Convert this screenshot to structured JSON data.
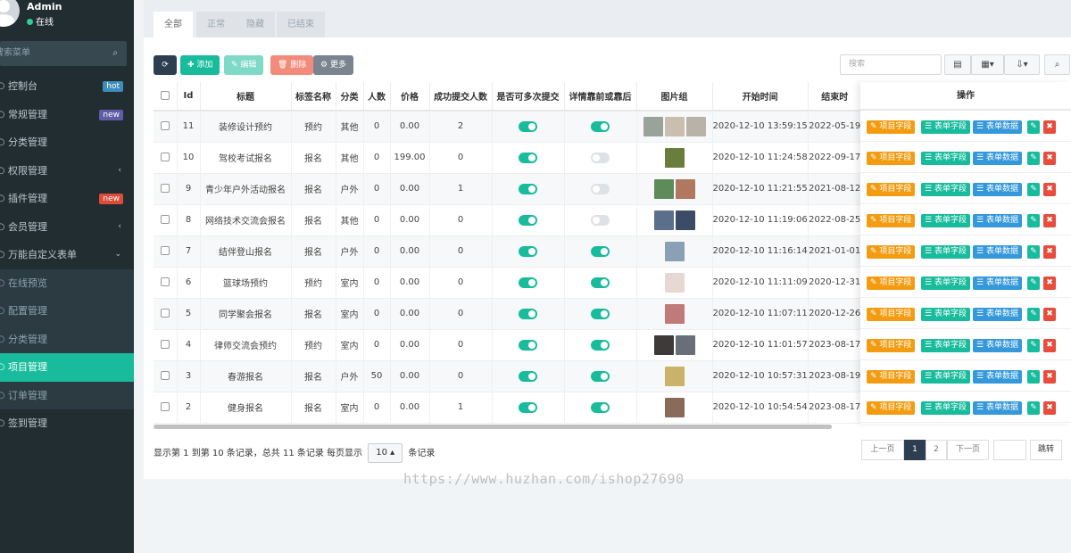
{
  "user": {
    "name": "Admin",
    "status": "在线"
  },
  "sidebar": {
    "search_placeholder": "搜索菜单",
    "items": [
      {
        "label": "控制台",
        "badge": "hot",
        "badge_color": "#3c8dbc"
      },
      {
        "label": "常规管理",
        "badge": "new",
        "badge_color": "#605ca8"
      },
      {
        "label": "分类管理"
      },
      {
        "label": "权限管理",
        "arrow": "‹"
      },
      {
        "label": "插件管理",
        "badge": "new",
        "badge_color": "#dd4b39"
      },
      {
        "label": "会员管理",
        "arrow": "‹"
      },
      {
        "label": "万能自定义表单",
        "arrow": "⌄"
      },
      {
        "label": "在线预览",
        "sub": true
      },
      {
        "label": "配置管理",
        "sub": true
      },
      {
        "label": "分类管理",
        "sub": true
      },
      {
        "label": "项目管理",
        "active": true
      },
      {
        "label": "订单管理",
        "sub": true
      },
      {
        "label": "签到管理"
      }
    ]
  },
  "tabs": [
    "全部",
    "正常",
    "隐藏",
    "已结束"
  ],
  "toolbar": {
    "refresh": "⟳",
    "add": "添加",
    "edit": "编辑",
    "delete": "删除",
    "more": "更多",
    "search_placeholder": "搜索"
  },
  "table": {
    "headers": [
      "Id",
      "标题",
      "标签名称",
      "分类",
      "人数",
      "价格",
      "成功提交人数",
      "是否可多次提交",
      "详情靠前或靠后",
      "图片组",
      "开始时间",
      "结束时"
    ],
    "ops_header": "操作",
    "op_labels": [
      "项目字段",
      "表单字段",
      "表单数据"
    ],
    "rows": [
      {
        "id": "11",
        "title": "装修设计预约",
        "tag": "预约",
        "cat": "其他",
        "num": "0",
        "price": "0.00",
        "success": "2",
        "multi": true,
        "front": true,
        "imgs": [
          "#9aa39a",
          "#c9bfae",
          "#b8b2a8"
        ],
        "start": "2020-12-10 13:59:15",
        "end": "2022-05-19"
      },
      {
        "id": "10",
        "title": "驾校考试报名",
        "tag": "报名",
        "cat": "其他",
        "num": "0",
        "price": "199.00",
        "success": "0",
        "multi": true,
        "front": false,
        "imgs": [
          "#6b7d3b"
        ],
        "start": "2020-12-10 11:24:58",
        "end": "2022-09-17"
      },
      {
        "id": "9",
        "title": "青少年户外活动报名",
        "tag": "报名",
        "cat": "户外",
        "num": "0",
        "price": "0.00",
        "success": "1",
        "multi": true,
        "front": false,
        "imgs": [
          "#5f8a5a",
          "#b07860"
        ],
        "start": "2020-12-10 11:21:55",
        "end": "2021-08-12"
      },
      {
        "id": "8",
        "title": "网络技术交流会报名",
        "tag": "报名",
        "cat": "其他",
        "num": "0",
        "price": "0.00",
        "success": "0",
        "multi": true,
        "front": false,
        "imgs": [
          "#5a6f8c",
          "#3d4c66"
        ],
        "start": "2020-12-10 11:19:06",
        "end": "2022-08-25"
      },
      {
        "id": "7",
        "title": "结伴登山报名",
        "tag": "报名",
        "cat": "户外",
        "num": "0",
        "price": "0.00",
        "success": "0",
        "multi": true,
        "front": true,
        "imgs": [
          "#8aa0b5"
        ],
        "start": "2020-12-10 11:16:14",
        "end": "2021-01-01"
      },
      {
        "id": "6",
        "title": "篮球场预约",
        "tag": "预约",
        "cat": "室内",
        "num": "0",
        "price": "0.00",
        "success": "0",
        "multi": true,
        "front": true,
        "imgs": [
          "#e8d8d4"
        ],
        "start": "2020-12-10 11:11:09",
        "end": "2020-12-31"
      },
      {
        "id": "5",
        "title": "同学聚会报名",
        "tag": "报名",
        "cat": "室内",
        "num": "0",
        "price": "0.00",
        "success": "0",
        "multi": true,
        "front": true,
        "imgs": [
          "#c07a78"
        ],
        "start": "2020-12-10 11:07:11",
        "end": "2020-12-26"
      },
      {
        "id": "4",
        "title": "律师交流会预约",
        "tag": "预约",
        "cat": "室内",
        "num": "0",
        "price": "0.00",
        "success": "0",
        "multi": true,
        "front": true,
        "imgs": [
          "#3e3a3a",
          "#6a6e78"
        ],
        "start": "2020-12-10 11:01:57",
        "end": "2023-08-17"
      },
      {
        "id": "3",
        "title": "春游报名",
        "tag": "报名",
        "cat": "户外",
        "num": "50",
        "price": "0.00",
        "success": "0",
        "multi": true,
        "front": true,
        "imgs": [
          "#c9b26a"
        ],
        "start": "2020-12-10 10:57:31",
        "end": "2023-08-19"
      },
      {
        "id": "2",
        "title": "健身报名",
        "tag": "报名",
        "cat": "室内",
        "num": "0",
        "price": "0.00",
        "success": "1",
        "multi": true,
        "front": true,
        "imgs": [
          "#8a6a5a"
        ],
        "start": "2020-12-10 10:54:54",
        "end": "2023-08-17"
      }
    ]
  },
  "footer": {
    "info": "显示第 1 到第 10 条记录，总共 11 条记录 每页显示",
    "page_size": "10",
    "suffix": "条记录"
  },
  "pagination": {
    "prev": "上一页",
    "pages": [
      "1",
      "2"
    ],
    "next": "下一页",
    "jump": "跳转"
  },
  "watermark": "https://www.huzhan.com/ishop27690"
}
